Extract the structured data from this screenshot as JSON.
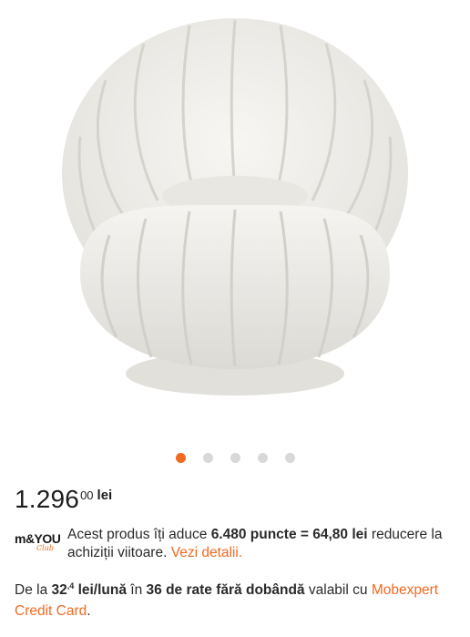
{
  "gallery": {
    "total": 5,
    "active": 0
  },
  "price": {
    "integer": "1.296",
    "decimals": "00",
    "currency": "lei"
  },
  "club": {
    "logo_main": "m&YOU",
    "logo_sub": "Club",
    "text_1": "Acest produs îți aduce",
    "points": "6.480 puncte = 64,80 lei",
    "text_2": "reducere la achiziții viitoare.",
    "link": "Vezi detalii."
  },
  "installments": {
    "prefix": "De la",
    "amount_int": "32",
    "amount_dec": ",4",
    "amount_unit": "lei/lună",
    "in": "în",
    "rates": "36 de rate fără dobândă",
    "suffix": "valabil cu",
    "card_link": "Mobexpert Credit Card",
    "end": "."
  },
  "colors": {
    "accent": "#f26a21",
    "text": "#222222",
    "dot_inactive": "#d8d8d8"
  }
}
